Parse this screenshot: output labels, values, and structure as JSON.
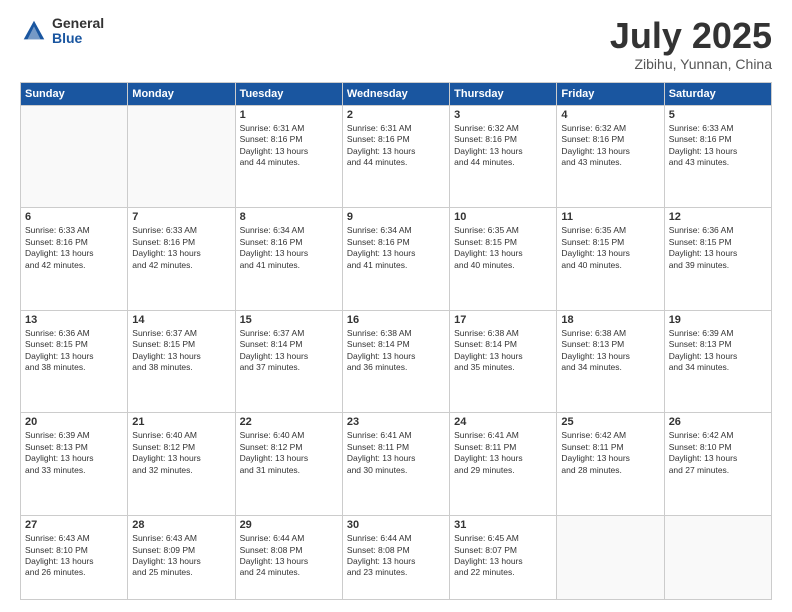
{
  "logo": {
    "general": "General",
    "blue": "Blue"
  },
  "header": {
    "month": "July 2025",
    "location": "Zibihu, Yunnan, China"
  },
  "weekdays": [
    "Sunday",
    "Monday",
    "Tuesday",
    "Wednesday",
    "Thursday",
    "Friday",
    "Saturday"
  ],
  "weeks": [
    [
      {
        "day": "",
        "lines": []
      },
      {
        "day": "",
        "lines": []
      },
      {
        "day": "1",
        "lines": [
          "Sunrise: 6:31 AM",
          "Sunset: 8:16 PM",
          "Daylight: 13 hours",
          "and 44 minutes."
        ]
      },
      {
        "day": "2",
        "lines": [
          "Sunrise: 6:31 AM",
          "Sunset: 8:16 PM",
          "Daylight: 13 hours",
          "and 44 minutes."
        ]
      },
      {
        "day": "3",
        "lines": [
          "Sunrise: 6:32 AM",
          "Sunset: 8:16 PM",
          "Daylight: 13 hours",
          "and 44 minutes."
        ]
      },
      {
        "day": "4",
        "lines": [
          "Sunrise: 6:32 AM",
          "Sunset: 8:16 PM",
          "Daylight: 13 hours",
          "and 43 minutes."
        ]
      },
      {
        "day": "5",
        "lines": [
          "Sunrise: 6:33 AM",
          "Sunset: 8:16 PM",
          "Daylight: 13 hours",
          "and 43 minutes."
        ]
      }
    ],
    [
      {
        "day": "6",
        "lines": [
          "Sunrise: 6:33 AM",
          "Sunset: 8:16 PM",
          "Daylight: 13 hours",
          "and 42 minutes."
        ]
      },
      {
        "day": "7",
        "lines": [
          "Sunrise: 6:33 AM",
          "Sunset: 8:16 PM",
          "Daylight: 13 hours",
          "and 42 minutes."
        ]
      },
      {
        "day": "8",
        "lines": [
          "Sunrise: 6:34 AM",
          "Sunset: 8:16 PM",
          "Daylight: 13 hours",
          "and 41 minutes."
        ]
      },
      {
        "day": "9",
        "lines": [
          "Sunrise: 6:34 AM",
          "Sunset: 8:16 PM",
          "Daylight: 13 hours",
          "and 41 minutes."
        ]
      },
      {
        "day": "10",
        "lines": [
          "Sunrise: 6:35 AM",
          "Sunset: 8:15 PM",
          "Daylight: 13 hours",
          "and 40 minutes."
        ]
      },
      {
        "day": "11",
        "lines": [
          "Sunrise: 6:35 AM",
          "Sunset: 8:15 PM",
          "Daylight: 13 hours",
          "and 40 minutes."
        ]
      },
      {
        "day": "12",
        "lines": [
          "Sunrise: 6:36 AM",
          "Sunset: 8:15 PM",
          "Daylight: 13 hours",
          "and 39 minutes."
        ]
      }
    ],
    [
      {
        "day": "13",
        "lines": [
          "Sunrise: 6:36 AM",
          "Sunset: 8:15 PM",
          "Daylight: 13 hours",
          "and 38 minutes."
        ]
      },
      {
        "day": "14",
        "lines": [
          "Sunrise: 6:37 AM",
          "Sunset: 8:15 PM",
          "Daylight: 13 hours",
          "and 38 minutes."
        ]
      },
      {
        "day": "15",
        "lines": [
          "Sunrise: 6:37 AM",
          "Sunset: 8:14 PM",
          "Daylight: 13 hours",
          "and 37 minutes."
        ]
      },
      {
        "day": "16",
        "lines": [
          "Sunrise: 6:38 AM",
          "Sunset: 8:14 PM",
          "Daylight: 13 hours",
          "and 36 minutes."
        ]
      },
      {
        "day": "17",
        "lines": [
          "Sunrise: 6:38 AM",
          "Sunset: 8:14 PM",
          "Daylight: 13 hours",
          "and 35 minutes."
        ]
      },
      {
        "day": "18",
        "lines": [
          "Sunrise: 6:38 AM",
          "Sunset: 8:13 PM",
          "Daylight: 13 hours",
          "and 34 minutes."
        ]
      },
      {
        "day": "19",
        "lines": [
          "Sunrise: 6:39 AM",
          "Sunset: 8:13 PM",
          "Daylight: 13 hours",
          "and 34 minutes."
        ]
      }
    ],
    [
      {
        "day": "20",
        "lines": [
          "Sunrise: 6:39 AM",
          "Sunset: 8:13 PM",
          "Daylight: 13 hours",
          "and 33 minutes."
        ]
      },
      {
        "day": "21",
        "lines": [
          "Sunrise: 6:40 AM",
          "Sunset: 8:12 PM",
          "Daylight: 13 hours",
          "and 32 minutes."
        ]
      },
      {
        "day": "22",
        "lines": [
          "Sunrise: 6:40 AM",
          "Sunset: 8:12 PM",
          "Daylight: 13 hours",
          "and 31 minutes."
        ]
      },
      {
        "day": "23",
        "lines": [
          "Sunrise: 6:41 AM",
          "Sunset: 8:11 PM",
          "Daylight: 13 hours",
          "and 30 minutes."
        ]
      },
      {
        "day": "24",
        "lines": [
          "Sunrise: 6:41 AM",
          "Sunset: 8:11 PM",
          "Daylight: 13 hours",
          "and 29 minutes."
        ]
      },
      {
        "day": "25",
        "lines": [
          "Sunrise: 6:42 AM",
          "Sunset: 8:11 PM",
          "Daylight: 13 hours",
          "and 28 minutes."
        ]
      },
      {
        "day": "26",
        "lines": [
          "Sunrise: 6:42 AM",
          "Sunset: 8:10 PM",
          "Daylight: 13 hours",
          "and 27 minutes."
        ]
      }
    ],
    [
      {
        "day": "27",
        "lines": [
          "Sunrise: 6:43 AM",
          "Sunset: 8:10 PM",
          "Daylight: 13 hours",
          "and 26 minutes."
        ]
      },
      {
        "day": "28",
        "lines": [
          "Sunrise: 6:43 AM",
          "Sunset: 8:09 PM",
          "Daylight: 13 hours",
          "and 25 minutes."
        ]
      },
      {
        "day": "29",
        "lines": [
          "Sunrise: 6:44 AM",
          "Sunset: 8:08 PM",
          "Daylight: 13 hours",
          "and 24 minutes."
        ]
      },
      {
        "day": "30",
        "lines": [
          "Sunrise: 6:44 AM",
          "Sunset: 8:08 PM",
          "Daylight: 13 hours",
          "and 23 minutes."
        ]
      },
      {
        "day": "31",
        "lines": [
          "Sunrise: 6:45 AM",
          "Sunset: 8:07 PM",
          "Daylight: 13 hours",
          "and 22 minutes."
        ]
      },
      {
        "day": "",
        "lines": []
      },
      {
        "day": "",
        "lines": []
      }
    ]
  ]
}
